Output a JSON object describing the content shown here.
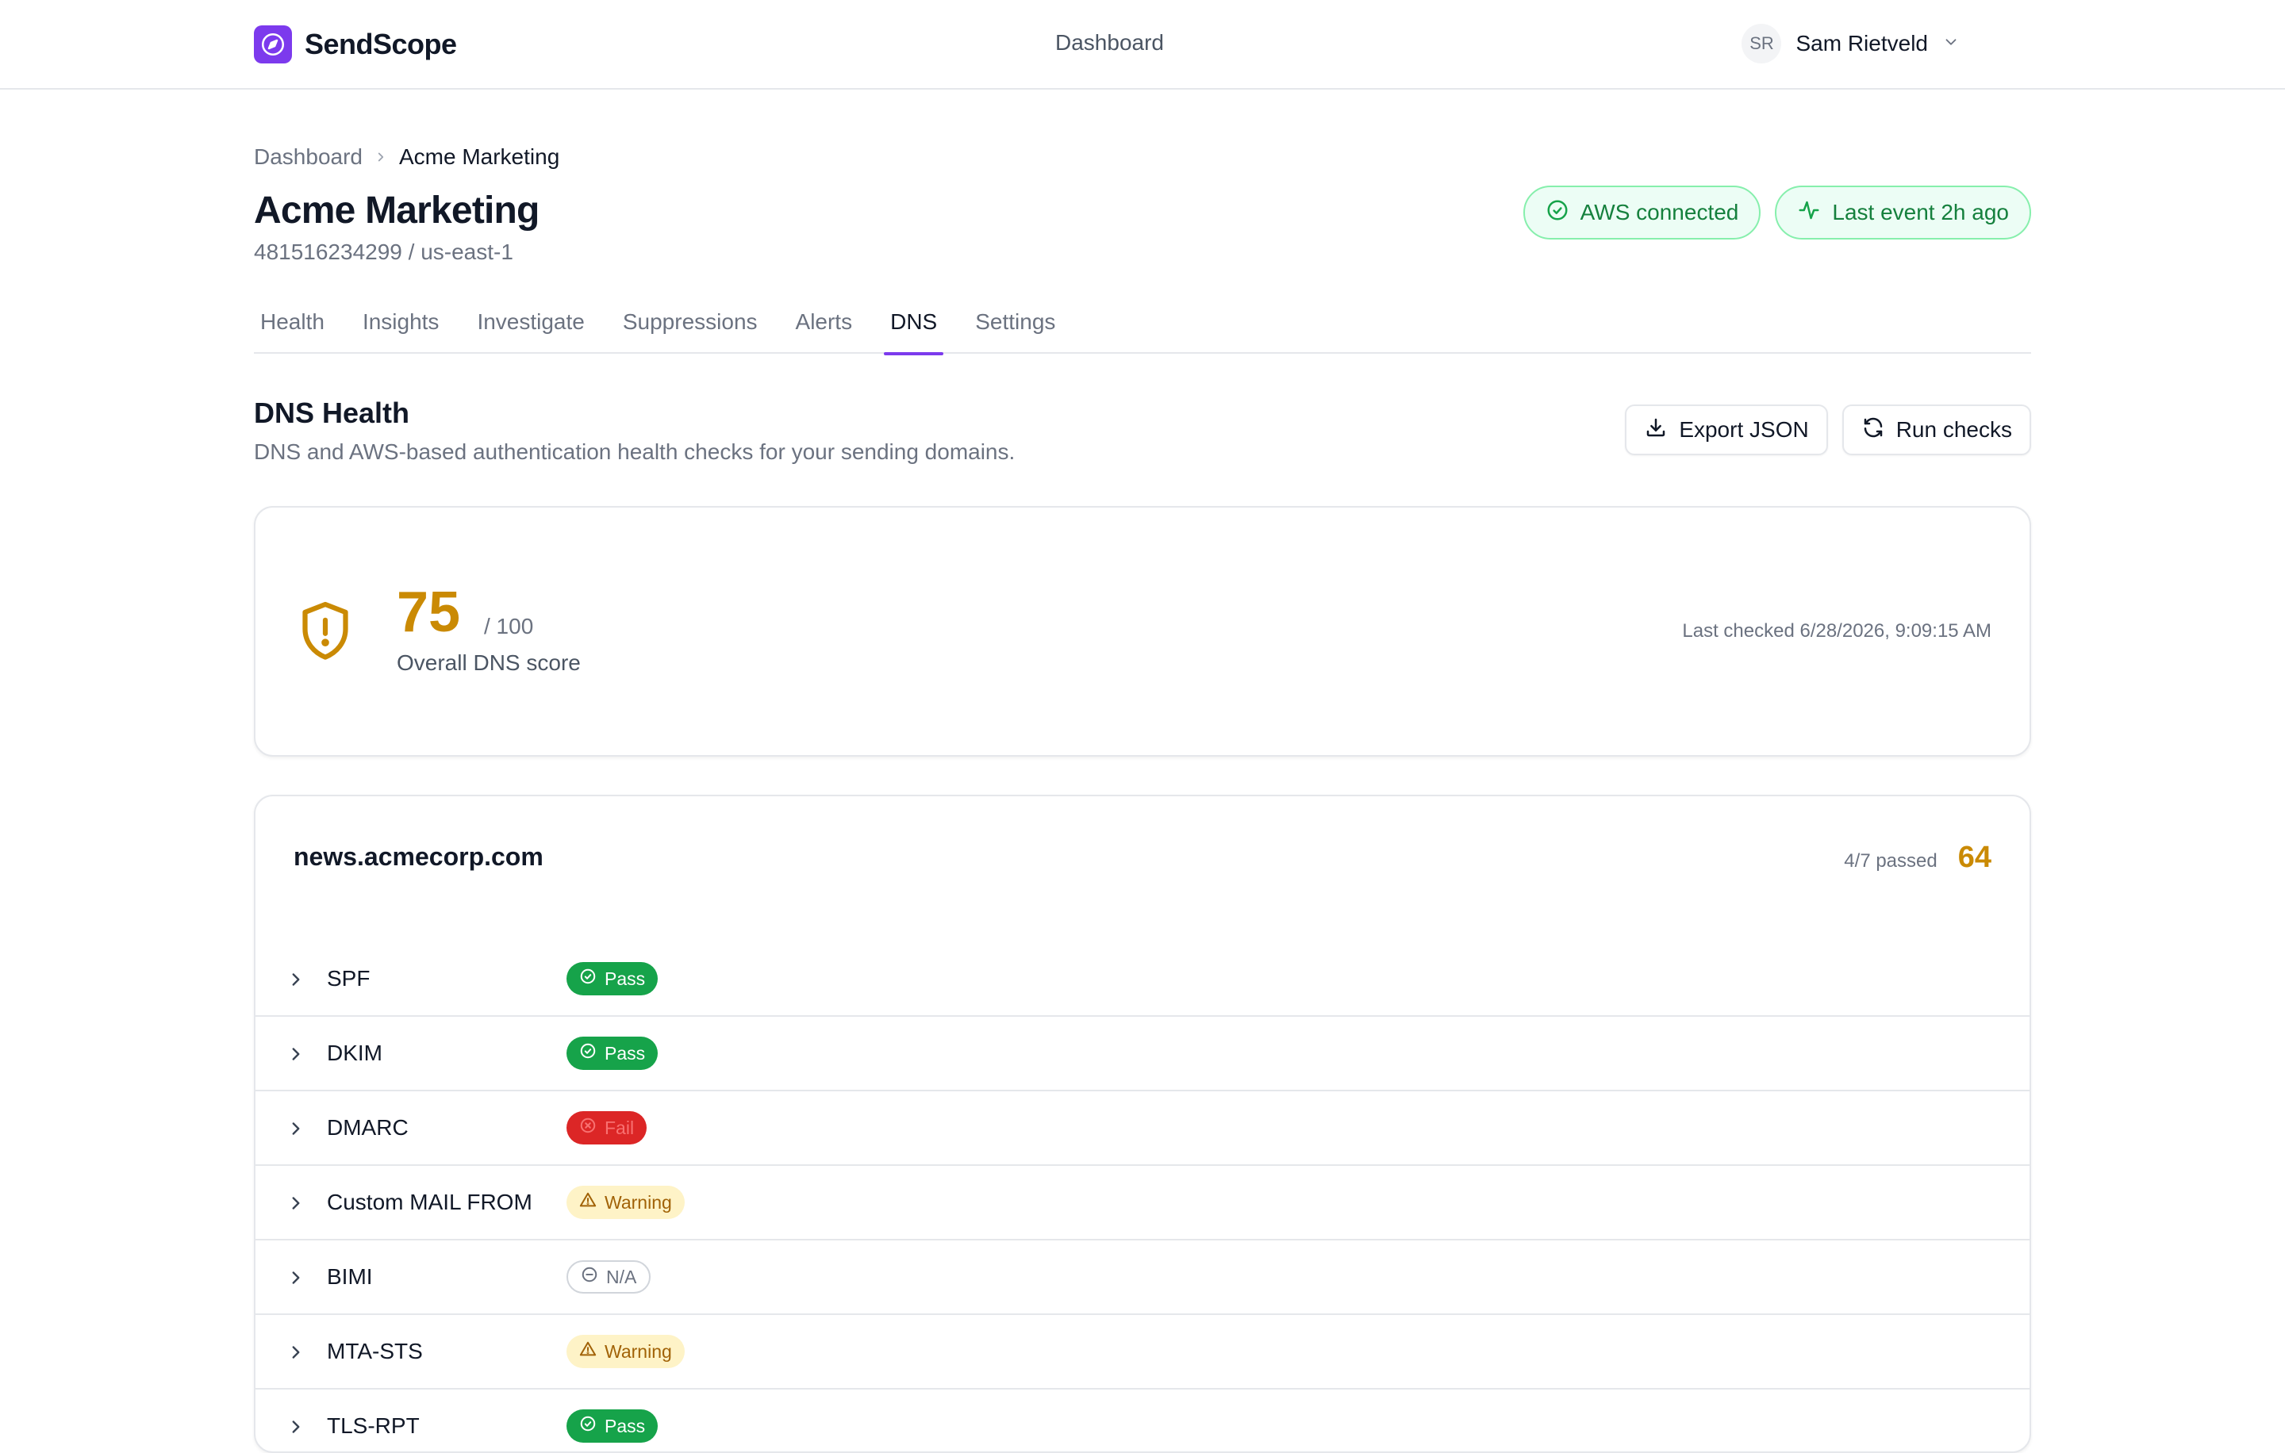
{
  "app": {
    "name": "SendScope"
  },
  "topnav": {
    "center_link": "Dashboard"
  },
  "user": {
    "initials": "SR",
    "name": "Sam Rietveld"
  },
  "breadcrumb": {
    "parent": "Dashboard",
    "current": "Acme Marketing"
  },
  "page": {
    "title": "Acme Marketing",
    "subtitle": "481516234299 / us-east-1"
  },
  "status": {
    "aws": "AWS connected",
    "last_event": "Last event 2h ago"
  },
  "tabs": [
    {
      "label": "Health"
    },
    {
      "label": "Insights"
    },
    {
      "label": "Investigate"
    },
    {
      "label": "Suppressions"
    },
    {
      "label": "Alerts"
    },
    {
      "label": "DNS",
      "active": true
    },
    {
      "label": "Settings"
    }
  ],
  "section": {
    "title": "DNS Health",
    "description": "DNS and AWS-based authentication health checks for your sending domains."
  },
  "actions": {
    "export_label": "Export JSON",
    "run_label": "Run checks"
  },
  "score": {
    "value": "75",
    "max": "/ 100",
    "label": "Overall DNS score",
    "last_checked": "Last checked 6/28/2026, 9:09:15 AM"
  },
  "domain": {
    "name": "news.acmecorp.com",
    "passed": "4/7 passed",
    "score": "64",
    "checks": [
      {
        "name": "SPF",
        "status": "Pass",
        "type": "pass"
      },
      {
        "name": "DKIM",
        "status": "Pass",
        "type": "pass"
      },
      {
        "name": "DMARC",
        "status": "Fail",
        "type": "fail"
      },
      {
        "name": "Custom MAIL FROM",
        "status": "Warning",
        "type": "warning"
      },
      {
        "name": "BIMI",
        "status": "N/A",
        "type": "na"
      },
      {
        "name": "MTA-STS",
        "status": "Warning",
        "type": "warning"
      },
      {
        "name": "TLS-RPT",
        "status": "Pass",
        "type": "pass"
      }
    ]
  },
  "colors": {
    "accent": "#7c3aed",
    "pass": "#16a34a",
    "fail": "#dc2626",
    "warning": "#ca8a04"
  }
}
